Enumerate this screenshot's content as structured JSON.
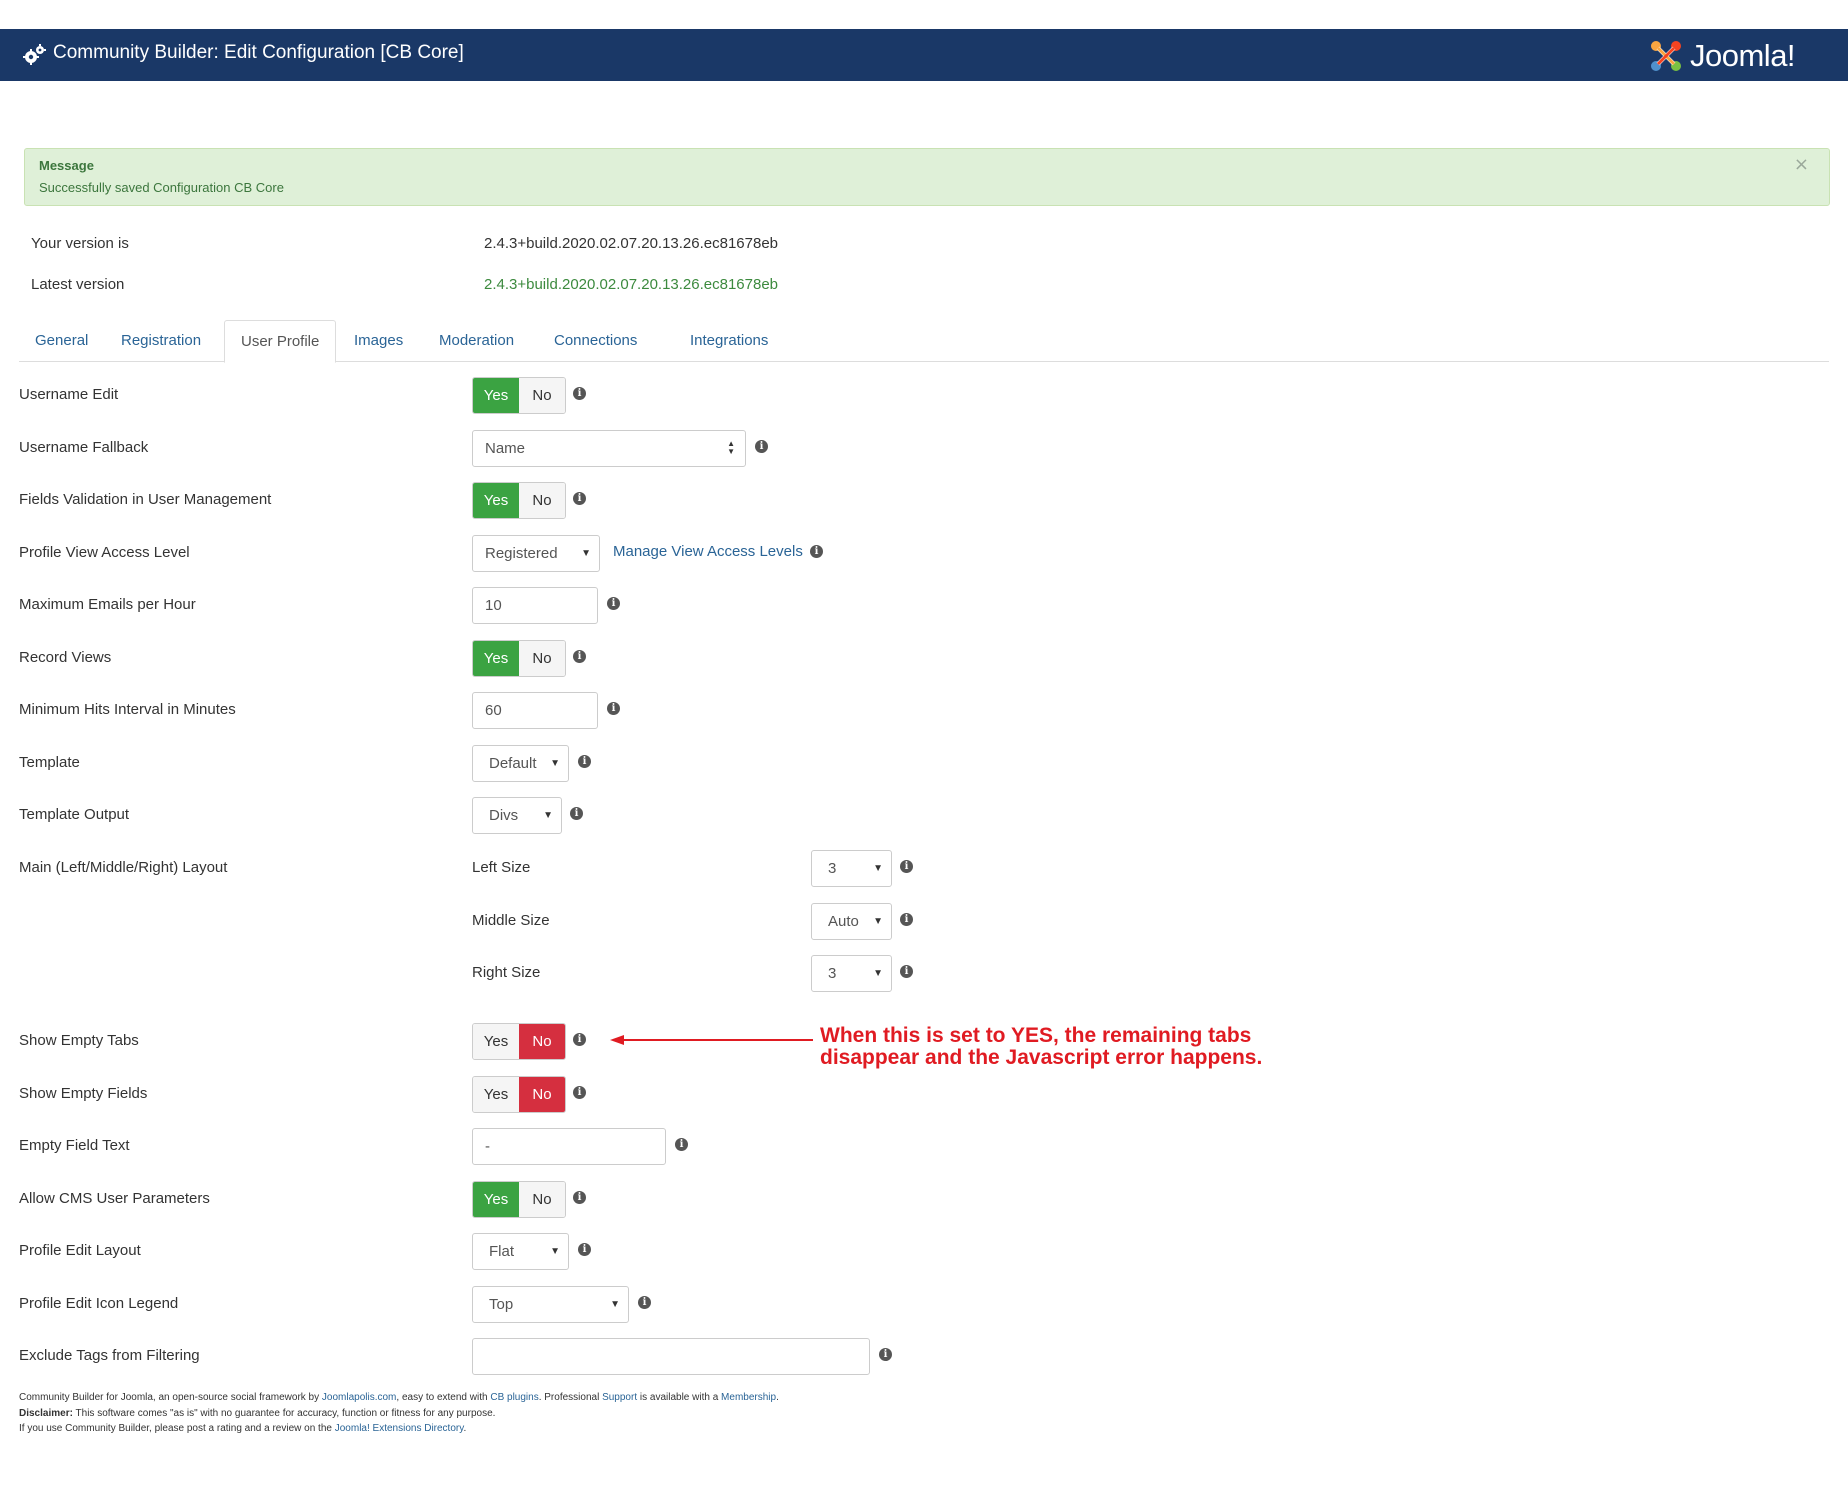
{
  "header": {
    "title": "Community Builder: Edit Configuration [CB Core]",
    "logo_text": "Joomla!"
  },
  "alert": {
    "title": "Message",
    "text": "Successfully saved Configuration CB Core",
    "close": "×"
  },
  "version": {
    "current_label": "Your version is",
    "current_value": "2.4.3+build.2020.02.07.20.13.26.ec81678eb",
    "latest_label": "Latest version",
    "latest_value": "2.4.3+build.2020.02.07.20.13.26.ec81678eb"
  },
  "tabs": [
    "General",
    "Registration",
    "User Profile",
    "Images",
    "Moderation",
    "Connections",
    "Integrations"
  ],
  "toggle": {
    "yes": "Yes",
    "no": "No"
  },
  "fields": {
    "username_edit": "Username Edit",
    "username_fallback": {
      "label": "Username Fallback",
      "value": "Name"
    },
    "fields_validation": "Fields Validation in User Management",
    "profile_view_access": {
      "label": "Profile View Access Level",
      "value": "Registered",
      "link": "Manage View Access Levels"
    },
    "max_emails": {
      "label": "Maximum Emails per Hour",
      "value": "10"
    },
    "record_views": "Record Views",
    "min_hits": {
      "label": "Minimum Hits Interval in Minutes",
      "value": "60"
    },
    "template": {
      "label": "Template",
      "value": "Default"
    },
    "template_output": {
      "label": "Template Output",
      "value": "Divs"
    },
    "main_layout": {
      "label": "Main (Left/Middle/Right) Layout",
      "left_label": "Left Size",
      "left_value": "3",
      "middle_label": "Middle Size",
      "middle_value": "Auto",
      "right_label": "Right Size",
      "right_value": "3"
    },
    "show_empty_tabs": "Show Empty Tabs",
    "show_empty_fields": "Show Empty Fields",
    "empty_field_text": {
      "label": "Empty Field Text",
      "value": "-"
    },
    "allow_cms_params": "Allow CMS User Parameters",
    "profile_edit_layout": {
      "label": "Profile Edit Layout",
      "value": "Flat"
    },
    "profile_edit_icon_legend": {
      "label": "Profile Edit Icon Legend",
      "value": "Top"
    },
    "exclude_tags": {
      "label": "Exclude Tags from Filtering",
      "value": ""
    }
  },
  "annotation": {
    "line1": "When this is set to YES, the remaining tabs",
    "line2": "disappear and the Javascript error happens.",
    "color": "#e01b22"
  },
  "footer": {
    "l1_a": "Community Builder for Joomla, an open-source social framework by ",
    "l1_link1": "Joomlapolis.com",
    "l1_b": ", easy to extend with ",
    "l1_link2": "CB plugins",
    "l1_c": ". Professional ",
    "l1_link3": "Support",
    "l1_d": " is available with a ",
    "l1_link4": "Membership",
    "l1_e": ".",
    "l2_bold": "Disclaimer:",
    "l2_text": " This software comes \"as is\" with no guarantee for accuracy, function or fitness for any purpose.",
    "l3_a": "If you use Community Builder, please post a rating and a review on the ",
    "l3_link": "Joomla! Extensions Directory",
    "l3_b": "."
  },
  "colors": {
    "header_bg": "#1a3867",
    "yes_active": "#3ba342",
    "no_active": "#d52f3f",
    "link": "#2a6496"
  }
}
